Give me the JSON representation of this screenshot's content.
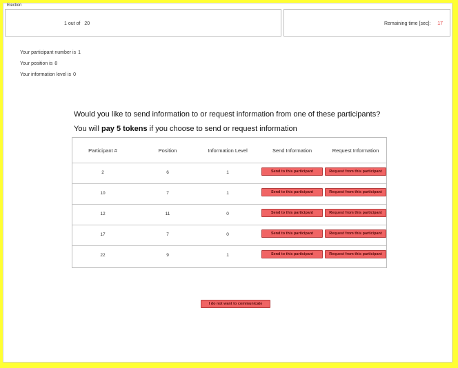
{
  "section_title": "Election",
  "period": {
    "current": "1",
    "sep": "out of",
    "total": "20"
  },
  "timer": {
    "label": "Remaining time [sec]:",
    "value": "17"
  },
  "participant_info": [
    {
      "label": "Your participant number is",
      "value": "1"
    },
    {
      "label": "Your position is",
      "value": "8"
    },
    {
      "label": "Your information level is",
      "value": "0"
    }
  ],
  "question": "Would you like to send information to or request information from one of these participants?",
  "cost": {
    "prefix": "You will",
    "bold": "pay 5 tokens",
    "suffix": "if you choose to send or request information"
  },
  "table": {
    "headers": [
      "Participant #",
      "Position",
      "Information Level",
      "Send Information",
      "Request Information"
    ],
    "rows": [
      {
        "participant": "2",
        "position": "6",
        "info_level": "1"
      },
      {
        "participant": "10",
        "position": "7",
        "info_level": "1"
      },
      {
        "participant": "12",
        "position": "11",
        "info_level": "0"
      },
      {
        "participant": "17",
        "position": "7",
        "info_level": "0"
      },
      {
        "participant": "22",
        "position": "9",
        "info_level": "1"
      }
    ],
    "send_label": "Send to this participant",
    "request_label": "Request from this participant"
  },
  "no_communicate_label": "I do not want to communicate",
  "colors": {
    "background": "#ffff33",
    "button": "#f06464",
    "timer_value": "#e23b3b"
  }
}
